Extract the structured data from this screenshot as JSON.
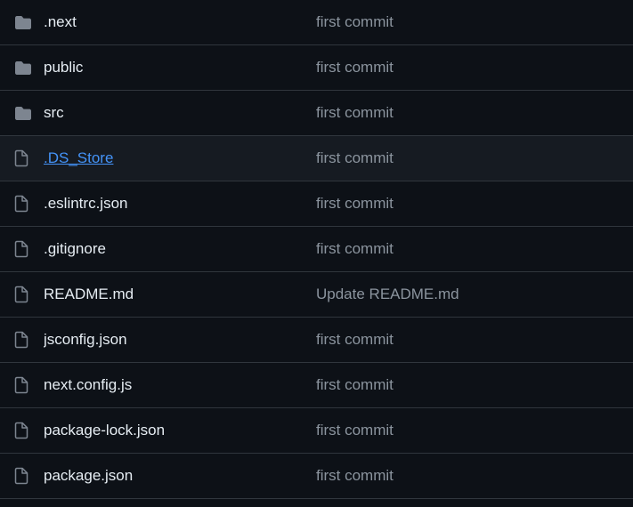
{
  "colors": {
    "background": "#0d1117",
    "row_hover": "#161b22",
    "divider": "#30363d",
    "text": "#e6edf3",
    "muted": "#8b949e",
    "link": "#4493f8",
    "folder_icon": "#7d8590"
  },
  "files": [
    {
      "name": ".next",
      "type": "folder",
      "icon": "folder-icon",
      "message": "first commit",
      "hovered": false
    },
    {
      "name": "public",
      "type": "folder",
      "icon": "folder-icon",
      "message": "first commit",
      "hovered": false
    },
    {
      "name": "src",
      "type": "folder",
      "icon": "folder-icon",
      "message": "first commit",
      "hovered": false
    },
    {
      "name": ".DS_Store",
      "type": "file",
      "icon": "file-icon",
      "message": "first commit",
      "hovered": true
    },
    {
      "name": ".eslintrc.json",
      "type": "file",
      "icon": "file-icon",
      "message": "first commit",
      "hovered": false
    },
    {
      "name": ".gitignore",
      "type": "file",
      "icon": "file-icon",
      "message": "first commit",
      "hovered": false
    },
    {
      "name": "README.md",
      "type": "file",
      "icon": "file-icon",
      "message": "Update README.md",
      "hovered": false
    },
    {
      "name": "jsconfig.json",
      "type": "file",
      "icon": "file-icon",
      "message": "first commit",
      "hovered": false
    },
    {
      "name": "next.config.js",
      "type": "file",
      "icon": "file-icon",
      "message": "first commit",
      "hovered": false
    },
    {
      "name": "package-lock.json",
      "type": "file",
      "icon": "file-icon",
      "message": "first commit",
      "hovered": false
    },
    {
      "name": "package.json",
      "type": "file",
      "icon": "file-icon",
      "message": "first commit",
      "hovered": false
    }
  ]
}
